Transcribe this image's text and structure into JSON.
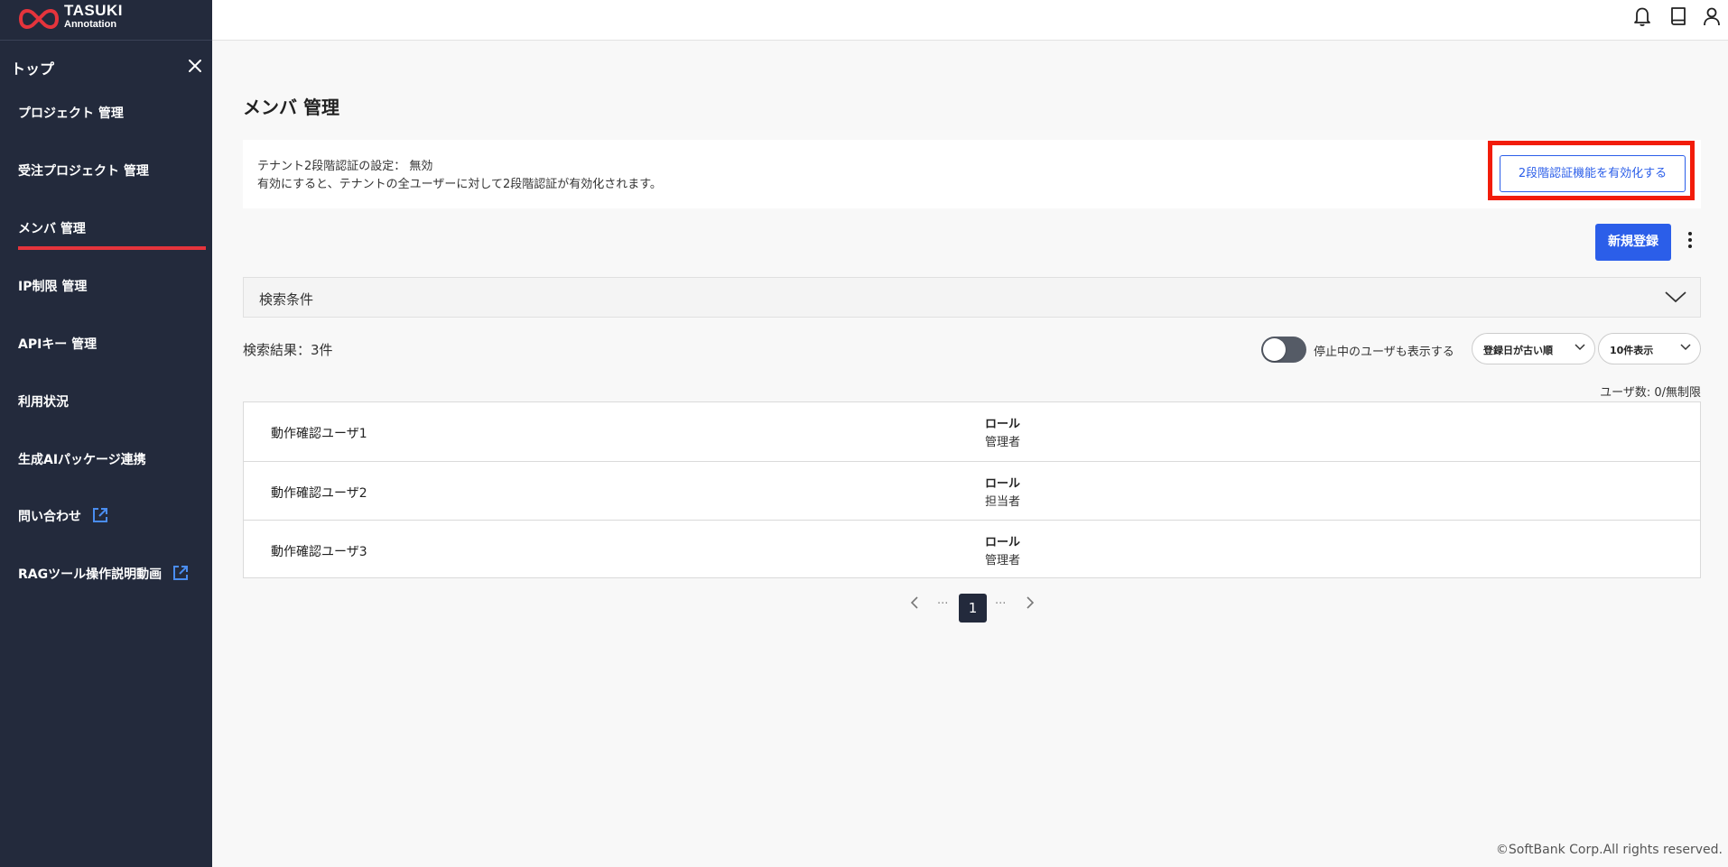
{
  "brand": {
    "line1": "TASUKI",
    "line2": "Annotation",
    "accent": "#e5343c"
  },
  "sidebar": {
    "top_label": "トップ",
    "items": [
      {
        "label": "プロジェクト 管理"
      },
      {
        "label": "受注プロジェクト 管理"
      },
      {
        "label": "メンバ 管理",
        "active": true
      },
      {
        "label": "IP制限 管理"
      },
      {
        "label": "APIキー 管理"
      },
      {
        "label": "利用状況"
      },
      {
        "label": "生成AIパッケージ連携"
      },
      {
        "label": "問い合わせ",
        "icon": "external-link-icon"
      },
      {
        "label": "RAGツール操作説明動画",
        "icon": "external-link-icon"
      }
    ]
  },
  "header": {
    "icons": [
      "bell-icon",
      "book-icon",
      "user-icon"
    ]
  },
  "main": {
    "title": "メンバ 管理",
    "mfa": {
      "line1": "テナント2段階認証の設定： 無効",
      "line2": "有効にすると、テナントの全ユーザーに対して2段階認証が有効化されます。",
      "button": "2段階認証機能を有効化する"
    },
    "new_button": "新規登録",
    "search_label": "検索条件",
    "result_count": "検索結果：3件",
    "toggle_label": "停止中のユーザも表示する",
    "sort_select": "登録日が古い順",
    "per_page_select": "10件表示",
    "user_count": "ユーザ数: 0/無制限",
    "members": [
      {
        "name": "動作確認ユーザ1",
        "role_header": "ロール",
        "role": "管理者"
      },
      {
        "name": "動作確認ユーザ2",
        "role_header": "ロール",
        "role": "担当者"
      },
      {
        "name": "動作確認ユーザ3",
        "role_header": "ロール",
        "role": "管理者"
      }
    ],
    "pagination": {
      "current": "1",
      "ellipsis": "···"
    }
  },
  "footer": "©SoftBank Corp.All rights reserved.",
  "colors": {
    "primary": "#2b5ee9",
    "sidebar_bg": "#232a3c",
    "highlight": "#f21c0a"
  }
}
